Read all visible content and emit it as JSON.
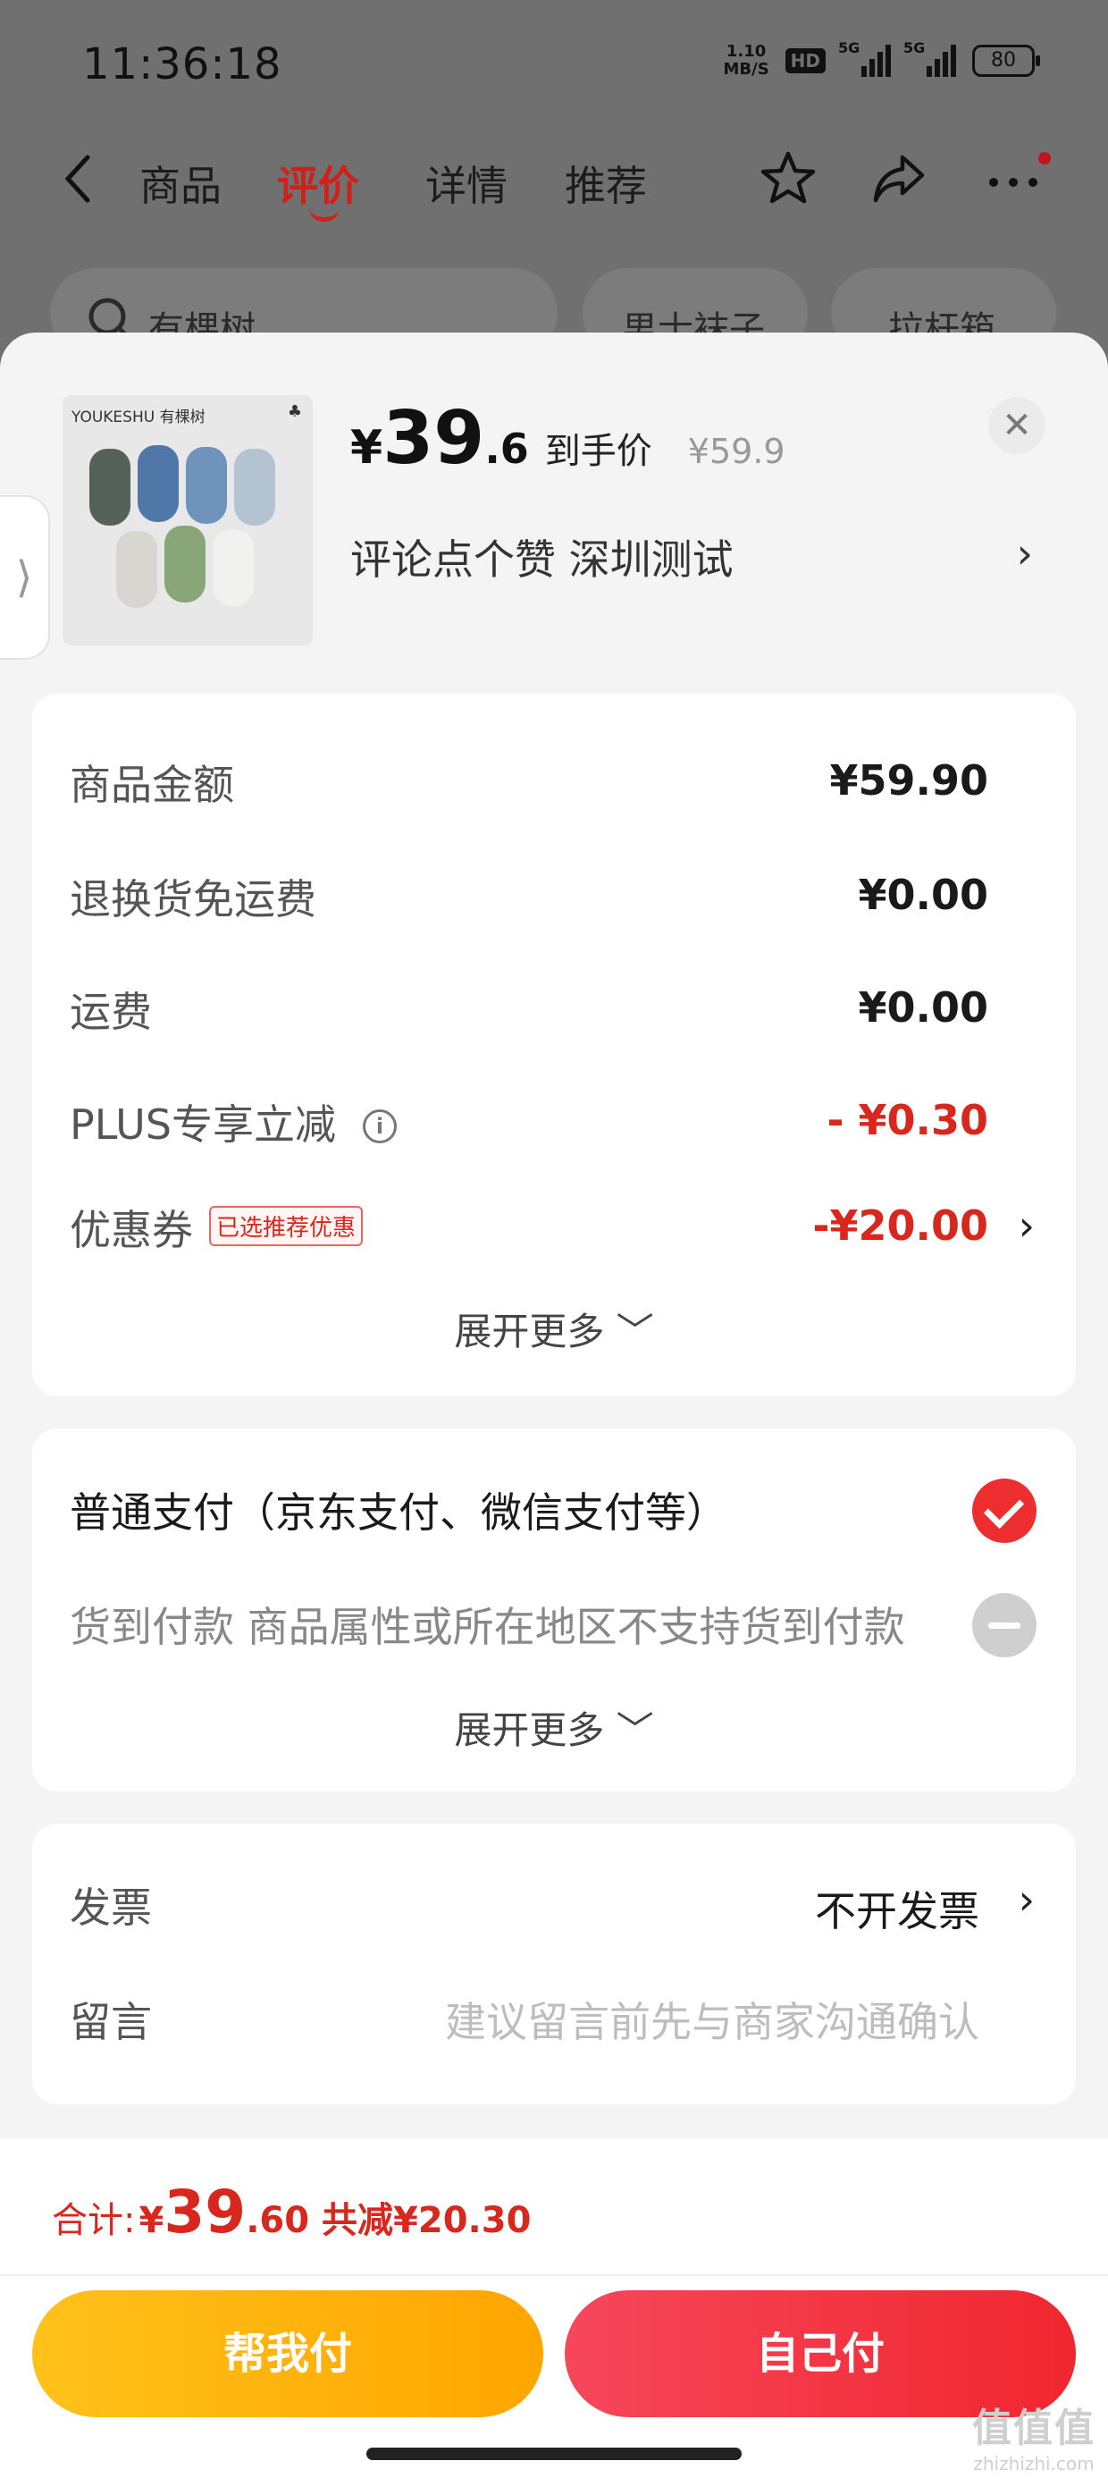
{
  "status_bar": {
    "time": "11:36:18",
    "net_speed_value": "1.10",
    "net_speed_unit": "MB/S",
    "hd": "HD",
    "sim1": "5G",
    "sim2": "5G",
    "battery": "80"
  },
  "nav": {
    "tabs": [
      "商品",
      "评价",
      "详情",
      "推荐"
    ],
    "active_tab": "评价",
    "icons": [
      "back-icon",
      "star-icon",
      "share-icon",
      "more-icon"
    ]
  },
  "chips": [
    "有棵树",
    "男士袜子",
    "拉杆箱"
  ],
  "product": {
    "brand": "YOUKESHU",
    "brand_cn": "有棵树",
    "currency": "¥",
    "price_int": "39",
    "price_dec": ".6",
    "price_tag": "到手价",
    "original_price": "¥59.9",
    "variant": "评论点个赞  深圳测试"
  },
  "sock_colors": [
    "#55625c",
    "#4f78a8",
    "#6f94bc",
    "#b3c3d1",
    "#d7d6d0",
    "#89a776",
    "#f1f1ef"
  ],
  "fees": {
    "rows": [
      {
        "label": "商品金额",
        "value": "¥59.90"
      },
      {
        "label": "退换货免运费",
        "value": "¥0.00"
      },
      {
        "label": "运费",
        "value": "¥0.00"
      },
      {
        "label": "PLUS专享立减",
        "value": "- ¥0.30"
      },
      {
        "label": "优惠券",
        "value": "-¥20.00",
        "badge": "已选推荐优惠"
      }
    ],
    "expand": "展开更多 ﹀"
  },
  "payment": {
    "option_normal": "普通支付（京东支付、微信支付等）",
    "option_cod": "货到付款 商品属性或所在地区不支持货到付款",
    "expand": "展开更多 ﹀"
  },
  "extras": {
    "invoice_label": "发票",
    "invoice_value": "不开发票",
    "message_label": "留言",
    "message_placeholder": "建议留言前先与商家沟通确认"
  },
  "footer": {
    "total_label": "合计:",
    "currency": "¥",
    "total_int": "39",
    "total_dec": ".60",
    "saved": "共减¥20.30",
    "btn_friend": "帮我付",
    "btn_self": "自己付"
  },
  "watermark": {
    "big": "值值值",
    "small": "zhizhizhi.com"
  },
  "colors": {
    "accent_red": "#d8271d",
    "pay_yellow": "#ffb400",
    "pay_red": "#f0262f"
  }
}
